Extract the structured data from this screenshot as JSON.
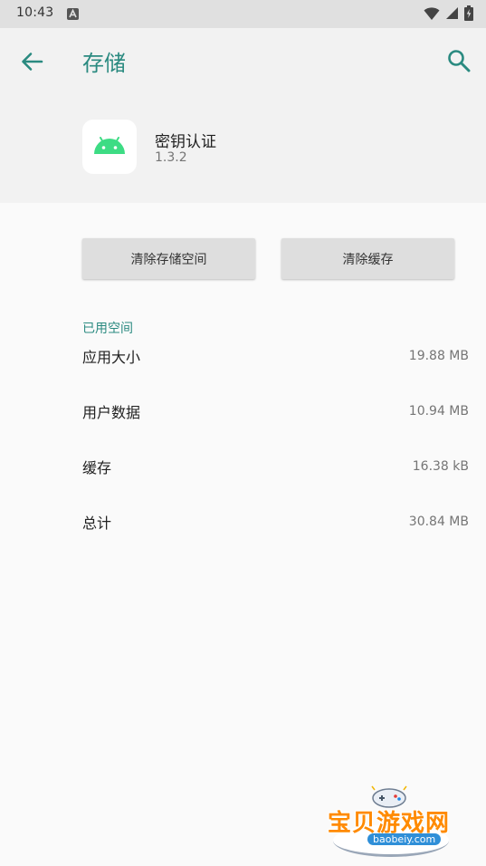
{
  "status_bar": {
    "time": "10:43",
    "icons": [
      "notification-a-icon",
      "wifi-icon",
      "signal-icon",
      "battery-charging-icon"
    ]
  },
  "app_bar": {
    "title": "存储",
    "back_icon": "arrow-back-icon",
    "search_icon": "search-icon"
  },
  "app_info": {
    "name": "密钥认证",
    "version": "1.3.2",
    "icon": "android-robot-icon"
  },
  "actions": {
    "clear_storage": "清除存储空间",
    "clear_cache": "清除缓存"
  },
  "usage": {
    "section_title": "已用空间",
    "rows": [
      {
        "label": "应用大小",
        "value": "19.88 MB"
      },
      {
        "label": "用户数据",
        "value": "10.94 MB"
      },
      {
        "label": "缓存",
        "value": "16.38 kB"
      },
      {
        "label": "总计",
        "value": "30.84 MB"
      }
    ]
  },
  "watermark": {
    "text": "宝贝游戏网",
    "url": "baobeiy.com"
  },
  "colors": {
    "accent": "#2a8a80",
    "android_green": "#3ddc84",
    "header_bg": "#f2f2f2",
    "button_bg": "#dedede"
  }
}
